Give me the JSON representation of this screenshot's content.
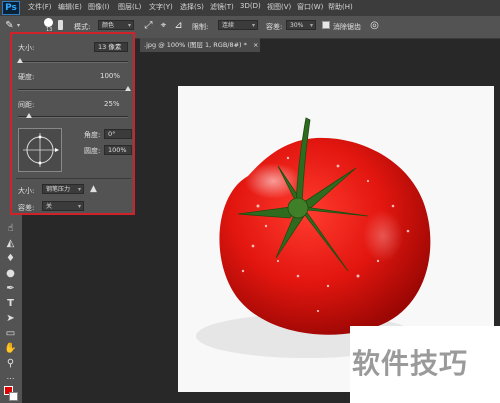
{
  "app": {
    "logo": "Ps"
  },
  "menu": [
    "文件(F)",
    "编辑(E)",
    "图像(I)",
    "图层(L)",
    "文字(Y)",
    "选择(S)",
    "滤镜(T)",
    "3D(D)",
    "视图(V)",
    "窗口(W)",
    "帮助(H)"
  ],
  "options_bar": {
    "mode_label": "模式:",
    "mode_value": "颜色",
    "limit_label": "限制:",
    "limit_value": "连续",
    "tolerance_label": "容差:",
    "tolerance_value": "30%",
    "antialias_label": "消除锯齿",
    "brush_size_badge": "13"
  },
  "document_tab": {
    "title": ".jpg @ 100% (图层 1, RGB/8#) *",
    "close": "×"
  },
  "brush_panel": {
    "size_label": "大小:",
    "size_value": "13 像素",
    "hardness_label": "硬度:",
    "hardness_value": "100%",
    "spacing_label": "间距:",
    "spacing_value": "25%",
    "angle_label": "角度:",
    "angle_value": "0°",
    "roundness_label": "圆度:",
    "roundness_value": "100%",
    "size_control_label": "大小:",
    "size_control_value": "钢笔压力",
    "tolerance_label": "容差:",
    "tolerance_value": "关",
    "size_slider_fraction": 0.02,
    "hardness_slider_fraction": 1.0,
    "spacing_slider_fraction": 0.1
  },
  "watermark": {
    "text": "软件技巧"
  },
  "colors": {
    "highlight_border": "#d0222a",
    "accent": "#31a8ff",
    "foreground": "#e00000",
    "background": "#ffffff"
  }
}
